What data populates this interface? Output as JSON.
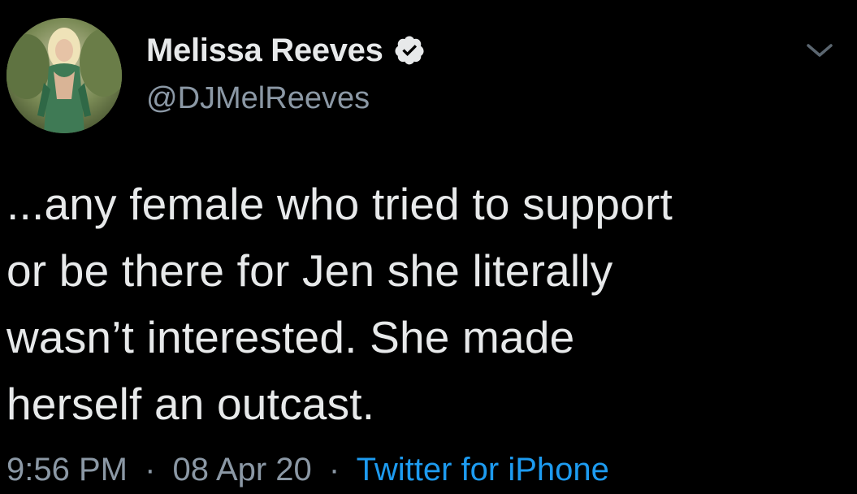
{
  "tweet": {
    "author": {
      "display_name": "Melissa Reeves",
      "handle": "@DJMelReeves",
      "verified": true
    },
    "text": "...any female who tried to support\nor be there for Jen she literally\nwasn’t interested. She made\nherself an outcast.",
    "meta": {
      "time": "9:56 PM",
      "separator": "·",
      "date": "08 Apr 20",
      "source": "Twitter for iPhone"
    }
  },
  "icons": {
    "verified": "verified-badge-icon",
    "menu": "chevron-down-icon"
  },
  "colors": {
    "background": "#000000",
    "text": "#e7e9ea",
    "secondary": "#8b98a5",
    "link": "#1d9bf0"
  }
}
